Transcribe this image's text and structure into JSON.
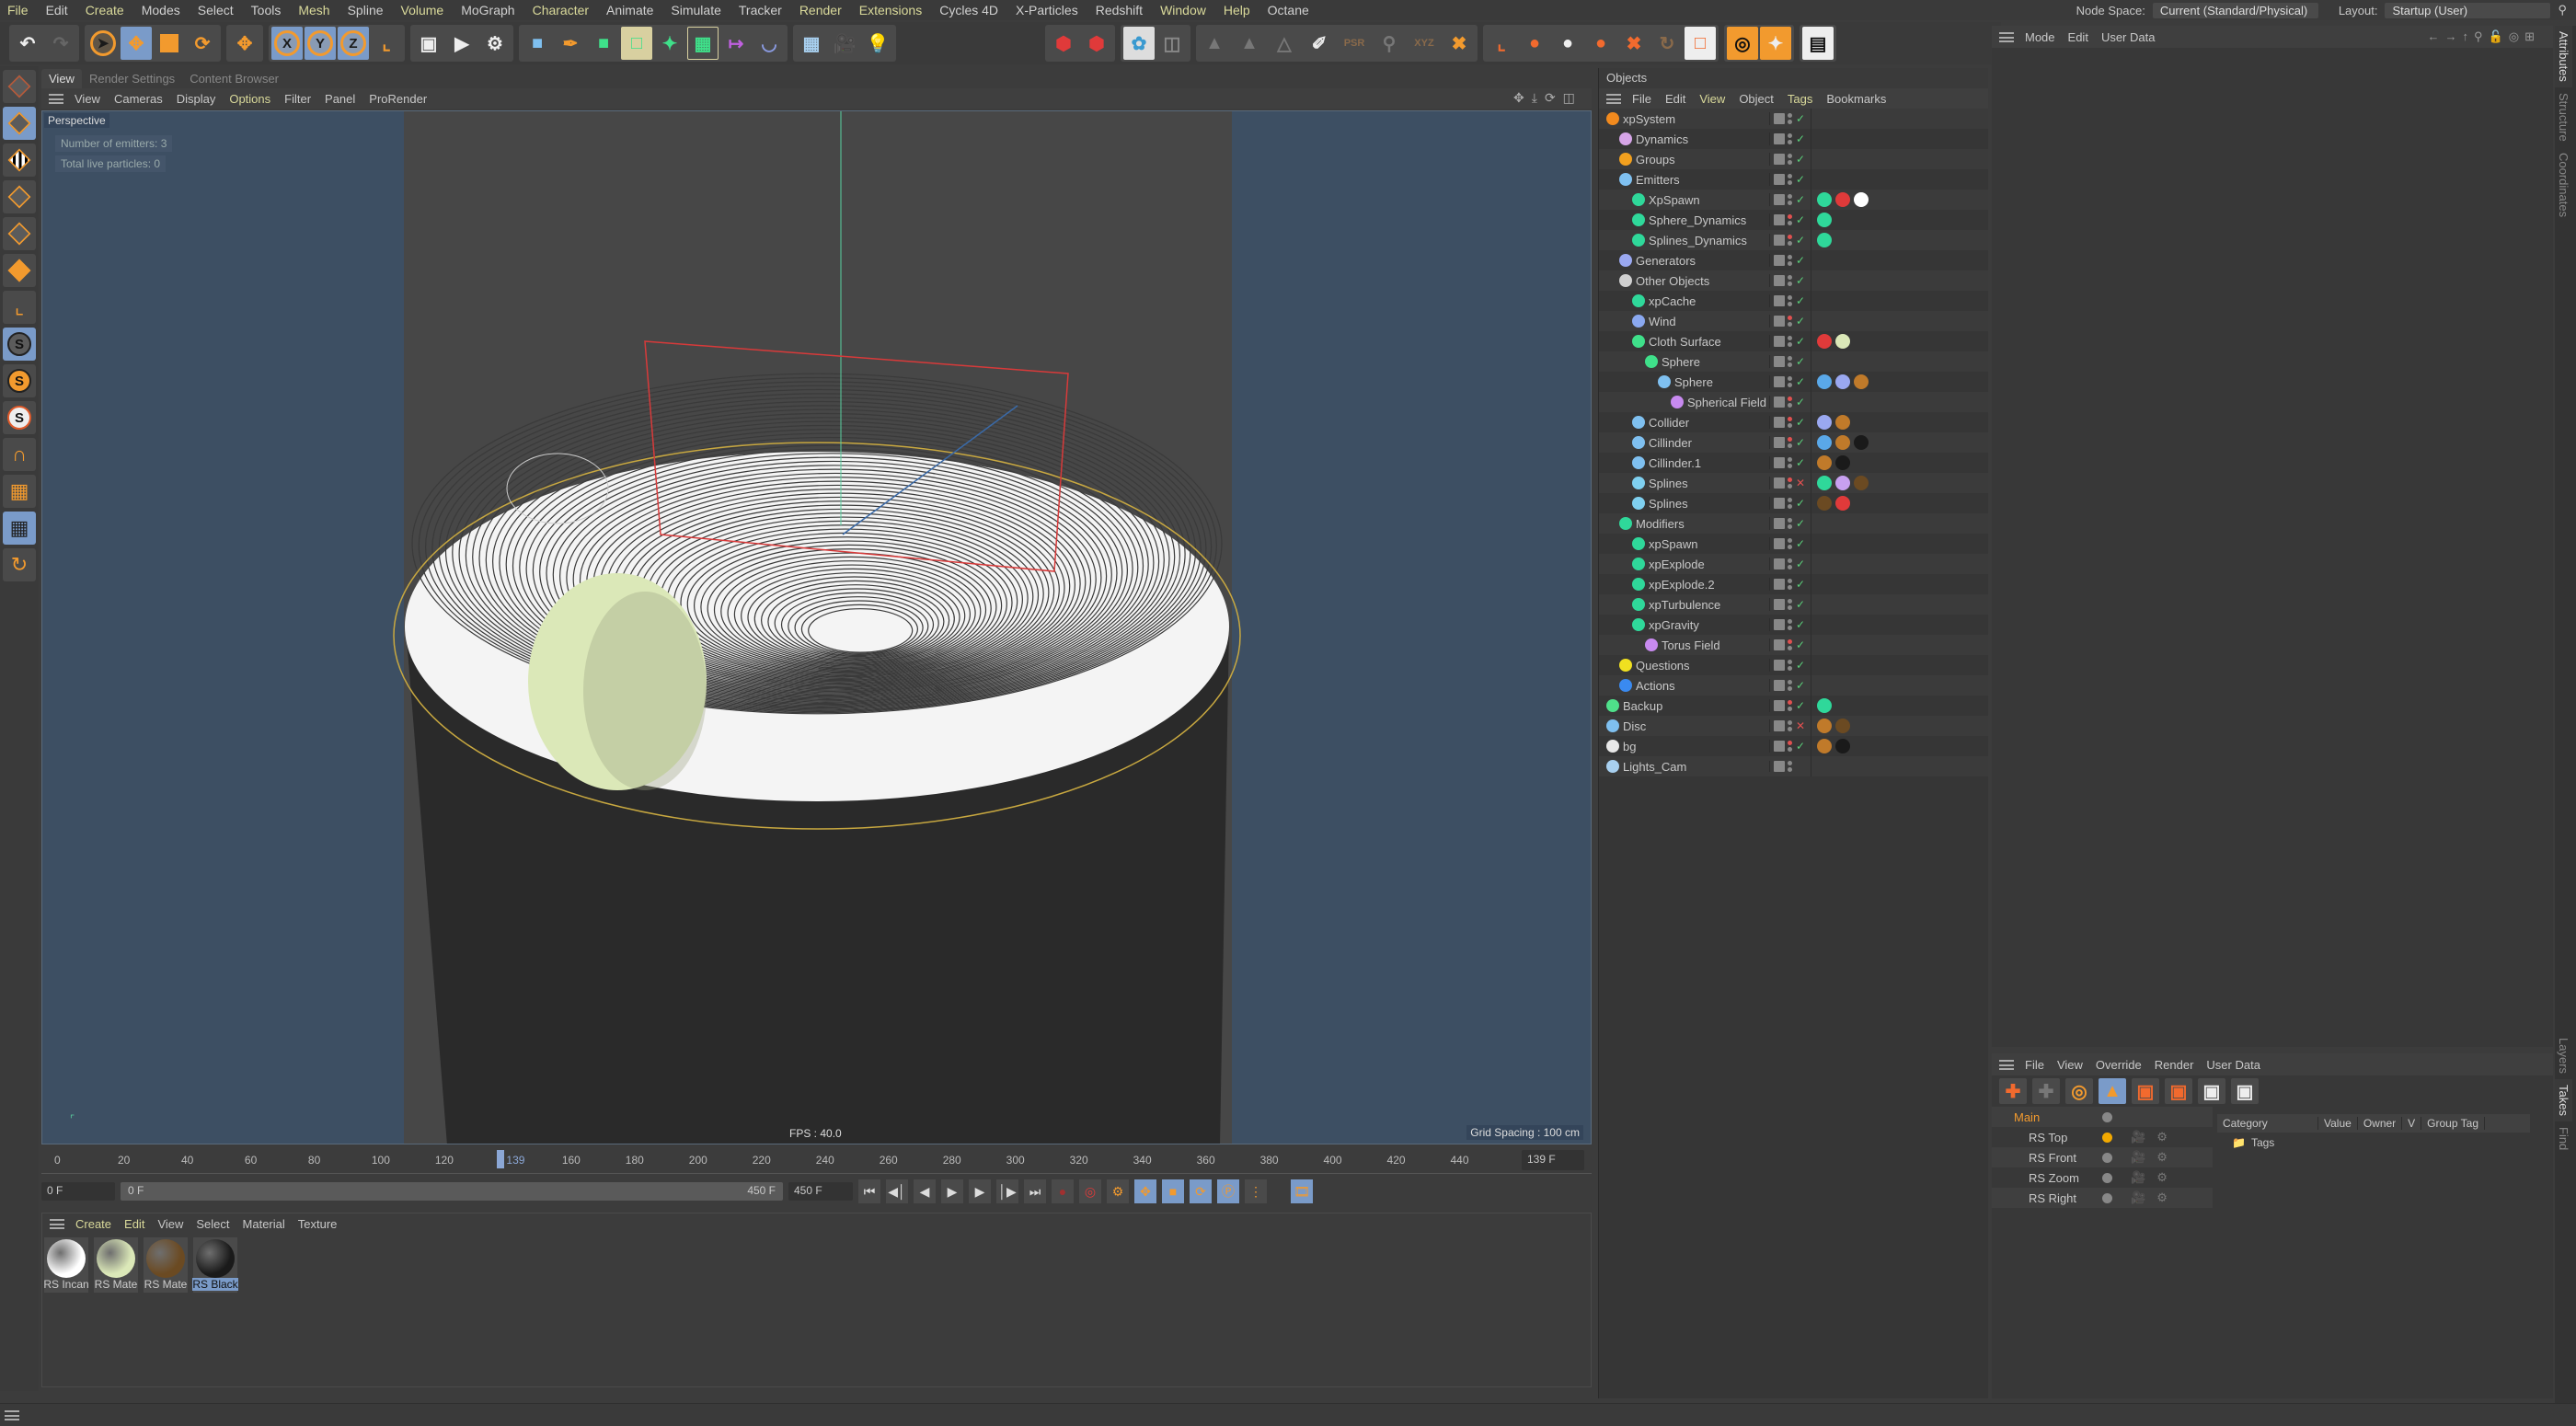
{
  "menubar": {
    "items": [
      {
        "label": "File",
        "hl": true
      },
      {
        "label": "Edit",
        "hl": false
      },
      {
        "label": "Create",
        "hl": true
      },
      {
        "label": "Modes",
        "hl": false
      },
      {
        "label": "Select",
        "hl": false
      },
      {
        "label": "Tools",
        "hl": false
      },
      {
        "label": "Mesh",
        "hl": true
      },
      {
        "label": "Spline",
        "hl": false
      },
      {
        "label": "Volume",
        "hl": true
      },
      {
        "label": "MoGraph",
        "hl": false
      },
      {
        "label": "Character",
        "hl": true
      },
      {
        "label": "Animate",
        "hl": false
      },
      {
        "label": "Simulate",
        "hl": false
      },
      {
        "label": "Tracker",
        "hl": false
      },
      {
        "label": "Render",
        "hl": true
      },
      {
        "label": "Extensions",
        "hl": true
      },
      {
        "label": "Cycles 4D",
        "hl": false
      },
      {
        "label": "X-Particles",
        "hl": false
      },
      {
        "label": "Redshift",
        "hl": false
      },
      {
        "label": "Window",
        "hl": true
      },
      {
        "label": "Help",
        "hl": true
      },
      {
        "label": "Octane",
        "hl": false
      }
    ],
    "node_space_label": "Node Space:",
    "node_space_value": "Current (Standard/Physical)",
    "layout_label": "Layout:",
    "layout_value": "Startup (User)"
  },
  "toolbar": {
    "axis_x": "X",
    "axis_y": "Y",
    "axis_z": "Z"
  },
  "viewport": {
    "tabs": [
      "View",
      "Render Settings",
      "Content Browser"
    ],
    "active_tab": "View",
    "menu": [
      {
        "label": "View",
        "hl": false
      },
      {
        "label": "Cameras",
        "hl": false
      },
      {
        "label": "Display",
        "hl": false
      },
      {
        "label": "Options",
        "hl": true
      },
      {
        "label": "Filter",
        "hl": false
      },
      {
        "label": "Panel",
        "hl": false
      },
      {
        "label": "ProRender",
        "hl": false
      }
    ],
    "camera": "Perspective",
    "hud_emitters": "Number of emitters: 3",
    "hud_particles": "Total live particles: 0",
    "fps": "FPS : 40.0",
    "grid_spacing": "Grid Spacing : 100 cm"
  },
  "timeline": {
    "ticks": [
      "0",
      "20",
      "40",
      "60",
      "80",
      "100",
      "120",
      "160",
      "180",
      "200",
      "220",
      "240",
      "260",
      "280",
      "300",
      "320",
      "340",
      "360",
      "380",
      "400",
      "420",
      "440"
    ],
    "tick_values": [
      0,
      20,
      40,
      60,
      80,
      100,
      120,
      160,
      180,
      200,
      220,
      240,
      260,
      280,
      300,
      320,
      340,
      360,
      380,
      400,
      420,
      440
    ],
    "current_frame_marker": "139",
    "current_frame_value": 139,
    "max_frame": 450,
    "current_frame_field": "139 F",
    "start_field": "0 F",
    "range_start": "0 F",
    "range_end": "450 F",
    "end_field": "450 F"
  },
  "materials": {
    "menu": [
      {
        "label": "Create",
        "hl": true
      },
      {
        "label": "Edit",
        "hl": true
      },
      {
        "label": "View",
        "hl": false
      },
      {
        "label": "Select",
        "hl": false
      },
      {
        "label": "Material",
        "hl": false
      },
      {
        "label": "Texture",
        "hl": false
      }
    ],
    "items": [
      {
        "name": "RS Incan",
        "color": "#ffffff",
        "selected": false
      },
      {
        "name": "RS Mate",
        "color": "#dbe8b8",
        "selected": false
      },
      {
        "name": "RS Mate",
        "color": "#6b4a22",
        "selected": false
      },
      {
        "name": "RS Black",
        "color": "#1a1a1a",
        "selected": true
      }
    ]
  },
  "objects": {
    "title": "Objects",
    "menu": [
      {
        "label": "File",
        "hl": false
      },
      {
        "label": "Edit",
        "hl": false
      },
      {
        "label": "View",
        "hl": true
      },
      {
        "label": "Object",
        "hl": false
      },
      {
        "label": "Tags",
        "hl": true
      },
      {
        "label": "Bookmarks",
        "hl": false
      }
    ],
    "rows": [
      {
        "name": "xpSystem",
        "depth": 0,
        "icon": "#f28a1e",
        "vis": "check",
        "dot": "grey",
        "tags": []
      },
      {
        "name": "Dynamics",
        "depth": 1,
        "icon": "#d6a5e8",
        "vis": "check",
        "dot": "grey",
        "tags": []
      },
      {
        "name": "Groups",
        "depth": 1,
        "icon": "#f2a01e",
        "vis": "check",
        "dot": "grey",
        "tags": []
      },
      {
        "name": "Emitters",
        "depth": 1,
        "icon": "#7fc0f0",
        "vis": "check",
        "dot": "grey",
        "tags": []
      },
      {
        "name": "XpSpawn",
        "depth": 2,
        "icon": "#2fd89a",
        "vis": "check",
        "dot": "grey",
        "tags": [
          "#2fd89a",
          "#e03a3a",
          "#ffffff"
        ]
      },
      {
        "name": "Sphere_Dynamics",
        "depth": 2,
        "icon": "#2fd89a",
        "vis": "check",
        "dot": "red",
        "tags": [
          "#2fd89a"
        ]
      },
      {
        "name": "Splines_Dynamics",
        "depth": 2,
        "icon": "#2fd89a",
        "vis": "check",
        "dot": "red",
        "tags": [
          "#2fd89a"
        ]
      },
      {
        "name": "Generators",
        "depth": 1,
        "icon": "#9aa8f0",
        "vis": "check",
        "dot": "grey",
        "tags": []
      },
      {
        "name": "Other Objects",
        "depth": 1,
        "icon": "#d0d0d0",
        "vis": "check",
        "dot": "grey",
        "tags": []
      },
      {
        "name": "xpCache",
        "depth": 2,
        "icon": "#2fd89a",
        "vis": "check",
        "dot": "grey",
        "tags": []
      },
      {
        "name": "Wind",
        "depth": 2,
        "icon": "#8aa8f0",
        "vis": "check",
        "dot": "red",
        "tags": []
      },
      {
        "name": "Cloth Surface",
        "depth": 2,
        "icon": "#3fe08a",
        "vis": "check",
        "dot": "grey",
        "tags": [
          "#e03a3a",
          "#dbe8b8"
        ]
      },
      {
        "name": "Sphere",
        "depth": 3,
        "icon": "#3fe08a",
        "vis": "check",
        "dot": "grey",
        "tags": []
      },
      {
        "name": "Sphere",
        "depth": 4,
        "icon": "#7fc0f0",
        "vis": "check",
        "dot": "grey",
        "tags": [
          "#5aa8e8",
          "#9aa8f0",
          "#c07a2a"
        ]
      },
      {
        "name": "Spherical Field",
        "depth": 5,
        "icon": "#c88af0",
        "vis": "check",
        "dot": "red",
        "tags": []
      },
      {
        "name": "Collider",
        "depth": 2,
        "icon": "#7fc0f0",
        "vis": "check",
        "dot": "red",
        "tags": [
          "#9aa8f0",
          "#c07a2a"
        ]
      },
      {
        "name": "Cillinder",
        "depth": 2,
        "icon": "#7fc0f0",
        "vis": "check",
        "dot": "red",
        "tags": [
          "#5aa8e8",
          "#c07a2a",
          "#1a1a1a"
        ]
      },
      {
        "name": "Cillinder.1",
        "depth": 2,
        "icon": "#7fc0f0",
        "vis": "check",
        "dot": "grey",
        "tags": [
          "#c07a2a",
          "#1a1a1a"
        ]
      },
      {
        "name": "Splines",
        "depth": 2,
        "icon": "#7fd0f0",
        "vis": "x",
        "dot": "red",
        "tags": [
          "#2fd89a",
          "#c8a0f0",
          "#6b4a22"
        ]
      },
      {
        "name": "Splines",
        "depth": 2,
        "icon": "#7fd0f0",
        "vis": "check",
        "dot": "grey",
        "tags": [
          "#6b4a22",
          "#e03a3a"
        ]
      },
      {
        "name": "Modifiers",
        "depth": 1,
        "icon": "#2fd89a",
        "vis": "check",
        "dot": "grey",
        "tags": []
      },
      {
        "name": "xpSpawn",
        "depth": 2,
        "icon": "#2fd89a",
        "vis": "check",
        "dot": "grey",
        "tags": []
      },
      {
        "name": "xpExplode",
        "depth": 2,
        "icon": "#2fd89a",
        "vis": "check",
        "dot": "grey",
        "tags": []
      },
      {
        "name": "xpExplode.2",
        "depth": 2,
        "icon": "#2fd89a",
        "vis": "check",
        "dot": "grey",
        "tags": []
      },
      {
        "name": "xpTurbulence",
        "depth": 2,
        "icon": "#2fd89a",
        "vis": "check",
        "dot": "grey",
        "tags": []
      },
      {
        "name": "xpGravity",
        "depth": 2,
        "icon": "#2fd89a",
        "vis": "check",
        "dot": "grey",
        "tags": []
      },
      {
        "name": "Torus Field",
        "depth": 3,
        "icon": "#c88af0",
        "vis": "check",
        "dot": "red",
        "tags": []
      },
      {
        "name": "Questions",
        "depth": 1,
        "icon": "#f0e020",
        "vis": "check",
        "dot": "grey",
        "tags": []
      },
      {
        "name": "Actions",
        "depth": 1,
        "icon": "#3a8af0",
        "vis": "check",
        "dot": "grey",
        "tags": []
      },
      {
        "name": "Backup",
        "depth": 0,
        "icon": "#4fe08a",
        "vis": "check",
        "dot": "red",
        "tags": [
          "#2fd89a"
        ]
      },
      {
        "name": "Disc",
        "depth": 0,
        "icon": "#7fc0f0",
        "vis": "x",
        "dot": "grey",
        "tags": [
          "#c07a2a",
          "#6b4a22"
        ]
      },
      {
        "name": "bg",
        "depth": 0,
        "icon": "#e8e8e8",
        "vis": "check",
        "dot": "red",
        "tags": [
          "#c07a2a",
          "#1a1a1a"
        ]
      },
      {
        "name": "Lights_Cam",
        "depth": 0,
        "icon": "#a8d0f0",
        "vis": "none",
        "dot": "grey",
        "tags": []
      }
    ]
  },
  "attributes": {
    "menu": [
      "Mode",
      "Edit",
      "User Data"
    ]
  },
  "side_tabs": [
    "Attributes",
    "Structure",
    "Coordinates"
  ],
  "takes": {
    "menu": [
      "File",
      "View",
      "Override",
      "Render",
      "User Data"
    ],
    "side_tabs": [
      "Layers",
      "Takes",
      "Find"
    ],
    "rows": [
      {
        "name": "Main",
        "active": false,
        "main": true
      },
      {
        "name": "RS Top",
        "active": true,
        "main": false
      },
      {
        "name": "RS Front",
        "active": false,
        "main": false
      },
      {
        "name": "RS Zoom",
        "active": false,
        "main": false
      },
      {
        "name": "RS Right",
        "active": false,
        "main": false
      }
    ],
    "columns": [
      "Category",
      "Value",
      "Owner",
      "V",
      "Group Tag"
    ],
    "tree_item": "Tags"
  }
}
